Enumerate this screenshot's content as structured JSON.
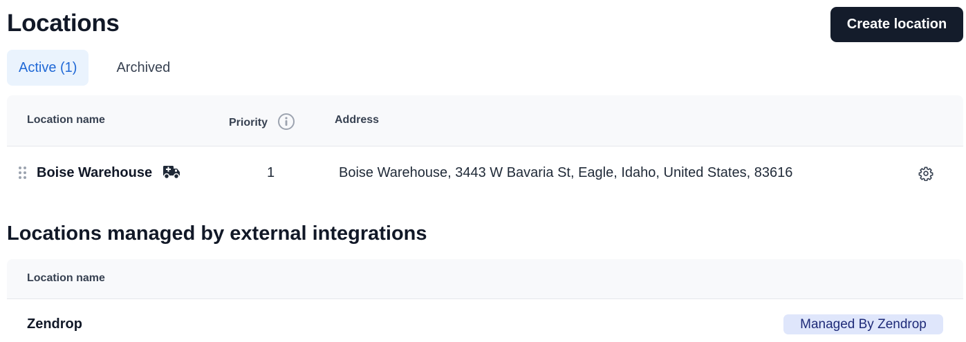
{
  "page": {
    "title": "Locations",
    "create_button": "Create location"
  },
  "tabs": [
    {
      "label": "Active (1)",
      "active": true
    },
    {
      "label": "Archived",
      "active": false
    }
  ],
  "locations_table": {
    "columns": {
      "name": "Location name",
      "priority": "Priority",
      "address": "Address"
    },
    "rows": [
      {
        "name": "Boise Warehouse",
        "name_icon": "truck-icon",
        "priority": "1",
        "address": "Boise Warehouse, 3443 W Bavaria St, Eagle, Idaho, United States, 83616",
        "action_icon": "gear-icon"
      }
    ]
  },
  "external": {
    "title": "Locations managed by external integrations",
    "columns": {
      "name": "Location name"
    },
    "rows": [
      {
        "name": "Zendrop",
        "badge": "Managed By Zendrop"
      }
    ]
  },
  "colors": {
    "primary_button": "#141c2b",
    "tab_active_bg": "#eaf3fd",
    "tab_active_text": "#1f68d6",
    "table_header_bg": "#f8f9fb",
    "badge_bg": "#dfe6fb",
    "badge_text": "#1e2a78"
  }
}
